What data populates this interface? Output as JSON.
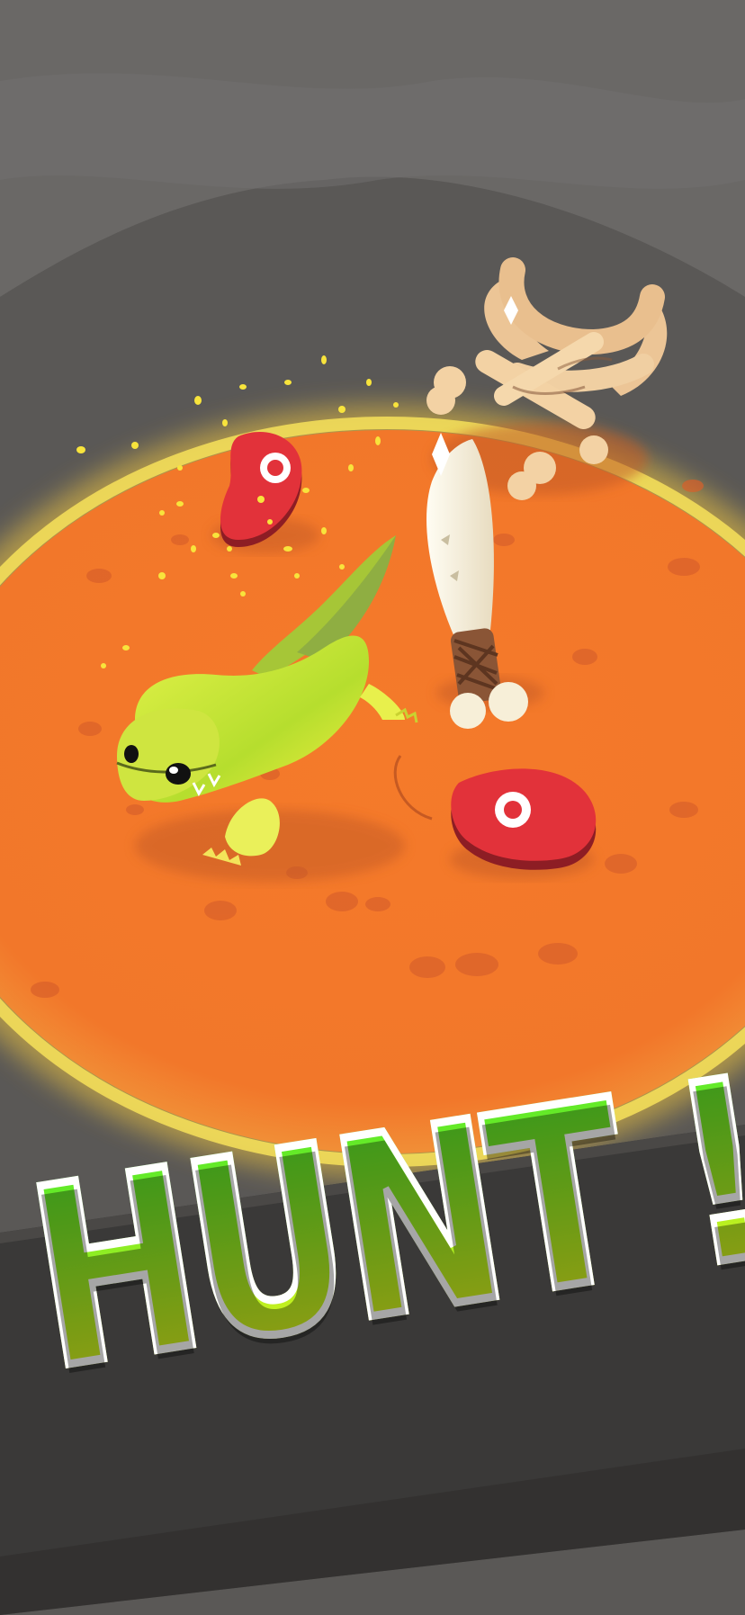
{
  "screen": {
    "headline": "HUNT !",
    "colors": {
      "background_rock": "#5e5c5a",
      "lava_arena": "#f07a2c",
      "lava_rim_glow": "#f3d34a",
      "dinosaur": "#c6e63a",
      "meat": "#e0343a",
      "bone": "#f3d2a4",
      "headline_top": "#4ee92a",
      "headline_bottom": "#e8f31c",
      "banner": "#3a3938"
    },
    "items": {
      "player": "green-dinosaur",
      "collectibles": [
        "meat",
        "meat"
      ],
      "weapon": "bone-knife",
      "obstacle": "bone-pile"
    }
  }
}
